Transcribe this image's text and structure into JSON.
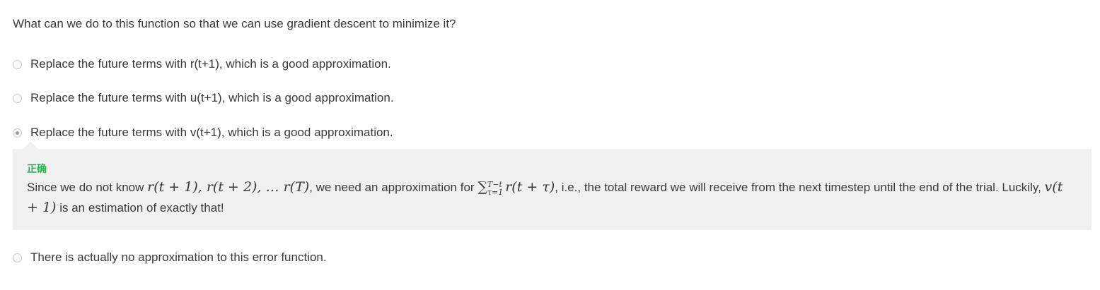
{
  "question": "What can we do to this function so that we can use gradient descent to minimize it?",
  "options": [
    {
      "label": "Replace the future terms with r(t+1), which is a good approximation.",
      "selected": false
    },
    {
      "label": "Replace the future terms with u(t+1), which is a good approximation.",
      "selected": false
    },
    {
      "label": "Replace the future terms with v(t+1), which is a good approximation.",
      "selected": true
    },
    {
      "label": "There is actually no approximation to this error function.",
      "selected": false
    }
  ],
  "feedback": {
    "status": "正确",
    "status_color": "#2bb24c",
    "text_parts": {
      "p1": "Since we do not know ",
      "m1": "r(t + 1), r(t + 2), … r(T)",
      "p2": ", we need an approximation for ",
      "sum_symbol": "∑",
      "sum_upper": "T−t",
      "sum_lower": "τ=1",
      "m2": "r(t + τ)",
      "p3": ", i.e., the total reward we will receive from the next timestep until the end of the trial. Luckily, ",
      "m3": "v(t + 1)",
      "p4": " is an estimation of exactly that!"
    }
  },
  "colors": {
    "feedback_background": "#f0f0f0",
    "text": "#373a3c",
    "radio_border": "#c9c9c9"
  }
}
